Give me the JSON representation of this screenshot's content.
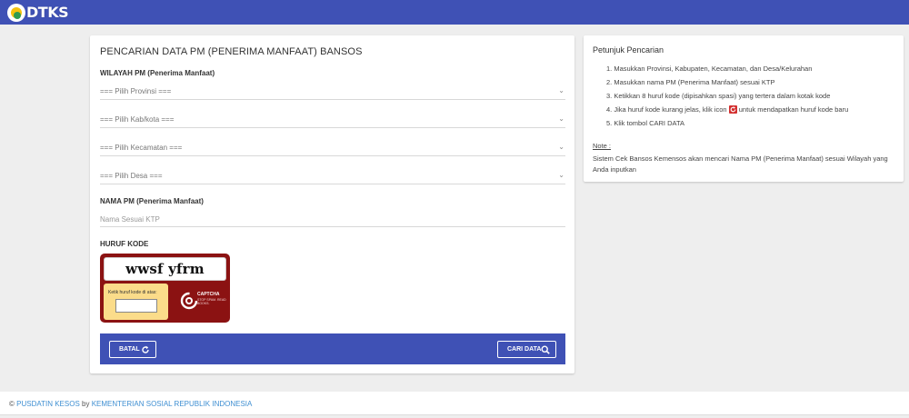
{
  "header": {
    "logo_text": "DTKS",
    "bg_color": "#3f51b5"
  },
  "search": {
    "title": "PENCARIAN DATA PM (PENERIMA MANFAAT) BANSOS",
    "region_label": "WILAYAH PM (Penerima Manfaat)",
    "province_placeholder": "=== Pilih Provinsi ===",
    "city_placeholder": "=== Pilih Kab/kota ===",
    "district_placeholder": "=== Pilih Kecamatan ===",
    "village_placeholder": "=== Pilih Desa ===",
    "name_label": "NAMA PM (Penerima Manfaat)",
    "name_placeholder": "Nama Sesuai KTP",
    "code_label": "HURUF KODE",
    "captcha_text": "wwsf yfrm",
    "captcha_entry_label": "Ketik huruf kode di atas:",
    "captcha_brand": "CAPTCHA",
    "captcha_tagline": "STOP SPAM. READ BOOKS.",
    "cancel_label": "BATAL",
    "submit_label": "CARI DATA"
  },
  "guide": {
    "title": "Petunjuk Pencarian",
    "steps": [
      "1. Masukkan Provinsi, Kabupaten, Kecamatan, dan Desa/Kelurahan",
      "2. Masukkan nama PM (Penerima Manfaat) sesuai KTP",
      "3. Ketikkan 8 huruf kode (dipisahkan spasi) yang tertera dalam kotak kode",
      "4. Jika huruf kode kurang jelas, klik icon",
      "untuk mendapatkan huruf kode baru",
      "5. Klik tombol CARI DATA"
    ],
    "note_label": "Note :",
    "note_text": "Sistem Cek Bansos Kemensos akan mencari Nama PM (Penerima Manfaat) sesuai Wilayah yang Anda inputkan"
  },
  "footer": {
    "copyright": "©",
    "org": "PUSDATIN KESOS",
    "by": "by",
    "ministry": "KEMENTERIAN SOSIAL REPUBLIK INDONESIA"
  },
  "icons": {
    "logo": "dtks-logo-icon",
    "dropdown": "chevron-down-icon",
    "refresh": "refresh-icon",
    "search": "search-icon"
  }
}
